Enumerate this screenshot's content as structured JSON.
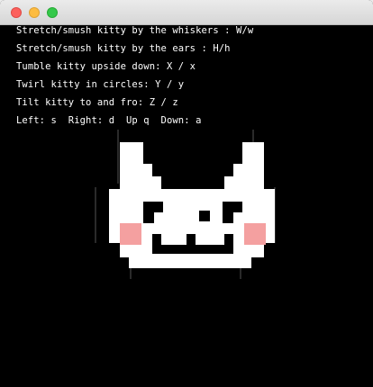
{
  "window": {
    "controls": {
      "close": "close-button",
      "minimize": "minimize-button",
      "zoom": "zoom-button"
    }
  },
  "instructions": [
    "Stretch/smush kitty by the whiskers : W/w",
    "Stretch/smush kitty by the ears : H/h",
    "Tumble kitty upside down: X / x",
    "Twirl kitty in circles: Y / y",
    "Tilt kitty to and fro: Z / z",
    "Left: s  Right: d  Up q  Down: a"
  ],
  "colors": {
    "background": "#000000",
    "text": "#ffffff",
    "kitty_body": "#ffffff",
    "cheeks": "#f4a0a0"
  }
}
